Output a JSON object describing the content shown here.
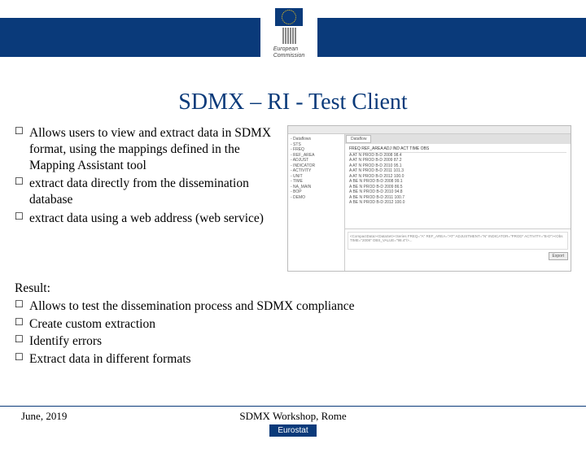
{
  "logo": {
    "line1": "European",
    "line2": "Commission"
  },
  "title": "SDMX – RI - Test Client",
  "bullets": [
    "Allows users to view and extract data in SDMX format, using the mappings defined in the Mapping Assistant tool",
    "extract data directly from the dissemination database",
    "extract data using a web address (web service)"
  ],
  "result_heading": "Result:",
  "result_bullets": [
    "Allows to test the dissemination process and SDMX compliance",
    "Create custom extraction",
    "Identify errors",
    "Extract data in different formats"
  ],
  "footer": {
    "left": "June, 2019",
    "center": "SDMX Workshop, Rome",
    "tag": "Eurostat"
  },
  "screenshot": {
    "tree": [
      "- Dataflows",
      "  - STS",
      "    - FREQ",
      "    - REF_AREA",
      "    - ADJUST",
      "    - INDICATOR",
      "    - ACTIVITY",
      "    - UNIT",
      "    - TIME",
      "  - NA_MAIN",
      "  - BOP",
      "  - DEMO"
    ],
    "tab": "Dataflow",
    "header": "FREQ  REF_AREA  ADJ  IND  ACT  TIME  OBS",
    "rows": [
      "A    AT    N   PROD  B-D  2008   98.4",
      "A    AT    N   PROD  B-D  2009   87.2",
      "A    AT    N   PROD  B-D  2010   95.1",
      "A    AT    N   PROD  B-D  2011  101.3",
      "A    AT    N   PROD  B-D  2012  100.0",
      "A    BE    N   PROD  B-D  2008   99.1",
      "A    BE    N   PROD  B-D  2009   86.5",
      "A    BE    N   PROD  B-D  2010   94.8",
      "A    BE    N   PROD  B-D  2011  100.7",
      "A    BE    N   PROD  B-D  2012  100.0"
    ],
    "xml": "<CompactData><DataSet><Series FREQ=\"A\" REF_AREA=\"AT\" ADJUSTMENT=\"N\" INDICATOR=\"PROD\" ACTIVITY=\"B-D\"><Obs TIME=\"2008\" OBS_VALUE=\"98.4\"/>...",
    "button": "Export"
  }
}
